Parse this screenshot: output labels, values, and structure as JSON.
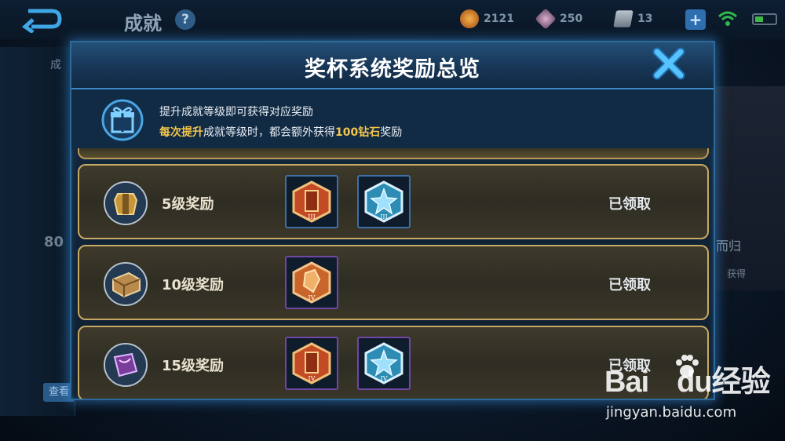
{
  "topbar": {
    "title": "成就",
    "help_icon_text": "?",
    "gold": "2121",
    "diamond": "250",
    "coupon": "13",
    "add_label": "+"
  },
  "background": {
    "left_label": "成",
    "left_number": "80",
    "left_button": "查看",
    "right_text": "而归",
    "right_sub": "获得"
  },
  "dialog": {
    "title": "奖杯系统奖励总览",
    "info_line1": "提升成就等级即可获得对应奖励",
    "info_line2": {
      "part1": "每次提升",
      "part2": "成就等级时，都会额外获得",
      "part3": "100钻石",
      "part4": "奖励"
    },
    "rows": [
      {
        "label": "5级奖励",
        "status": "已领取",
        "avatar_icon": "golden-armor-icon",
        "badges": [
          {
            "icon": "red-shield-badge-icon",
            "tier": "III",
            "frame": "blue"
          },
          {
            "icon": "blue-star-badge-icon",
            "tier": "III",
            "frame": "blue"
          }
        ]
      },
      {
        "label": "10级奖励",
        "status": "已领取",
        "avatar_icon": "wooden-chest-icon",
        "badges": [
          {
            "icon": "crystal-badge-icon",
            "tier": "IV",
            "frame": "purple"
          }
        ]
      },
      {
        "label": "15级奖励",
        "status": "已领取",
        "avatar_icon": "purple-book-icon",
        "badges": [
          {
            "icon": "red-shield-badge-icon",
            "tier": "IV",
            "frame": "purple"
          },
          {
            "icon": "blue-star-badge-icon",
            "tier": "IV",
            "frame": "purple"
          }
        ]
      }
    ]
  },
  "watermark": {
    "logo_a": "Bai",
    "logo_b": "du",
    "logo_c": "经验",
    "url": "jingyan.baidu.com"
  },
  "colors": {
    "accent_blue": "#3b86c4",
    "gold_highlight": "#f6c64a",
    "row_border": "#c7a964"
  }
}
